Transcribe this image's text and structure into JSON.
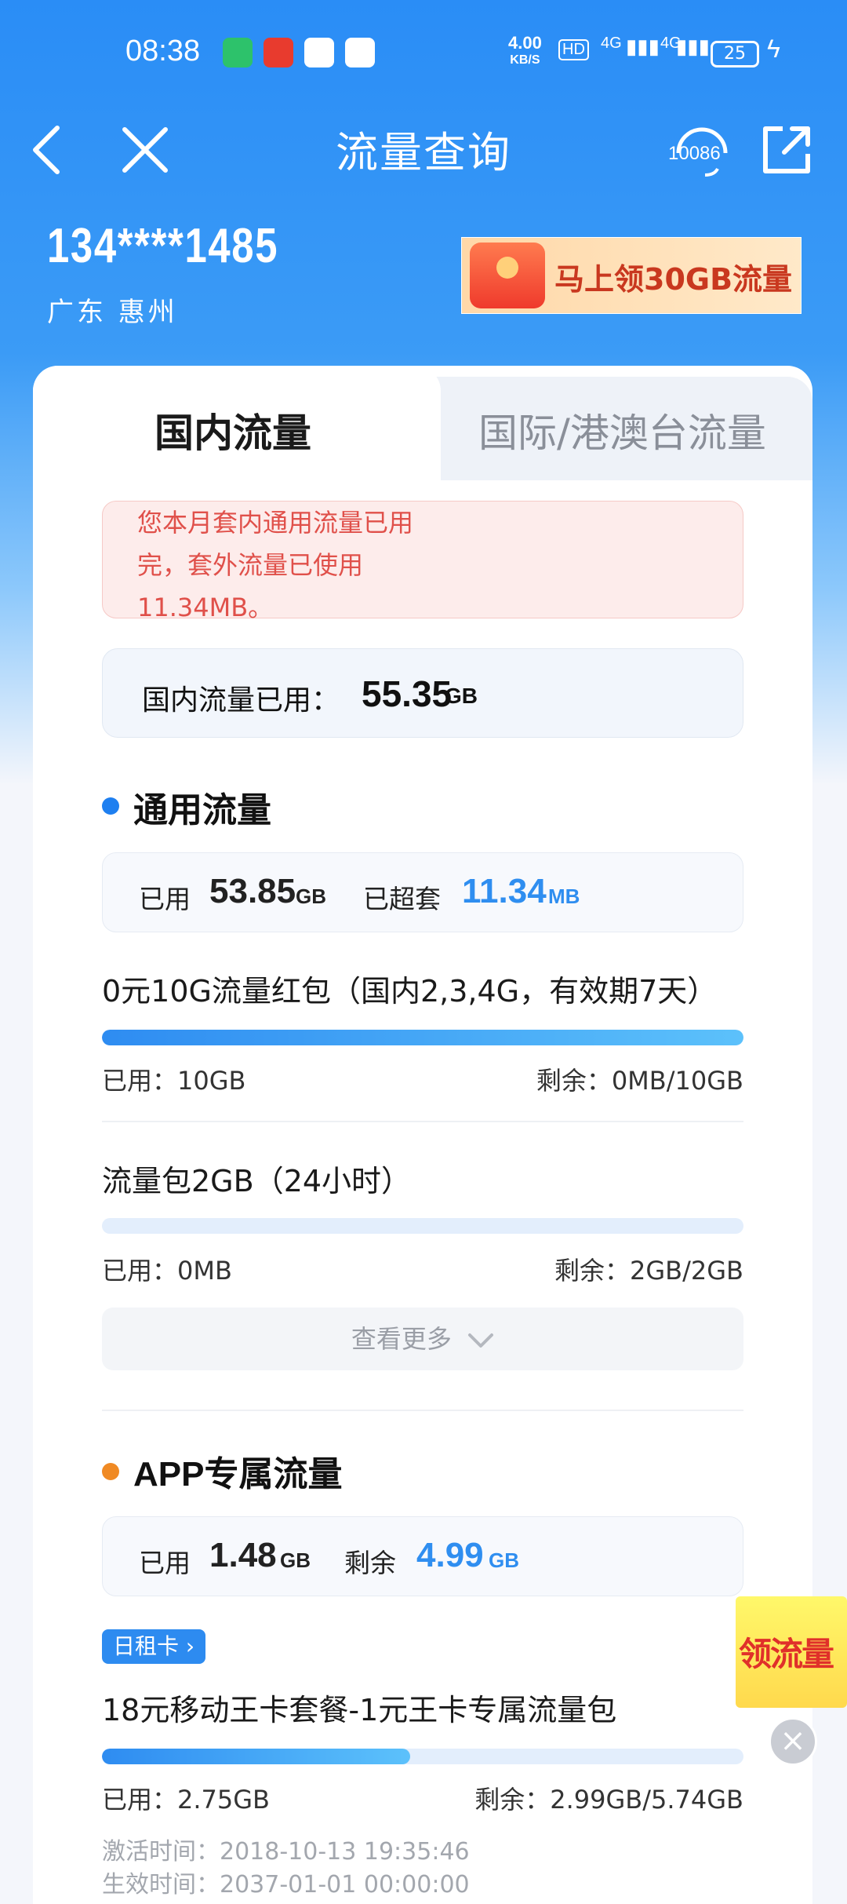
{
  "status_bar": {
    "time": "08:38",
    "net_speed_value": "4.00",
    "net_speed_unit": "KB/S",
    "hd_label": "HD",
    "signal_1": "4G",
    "signal_2": "4G",
    "battery": "25"
  },
  "nav": {
    "title": "流量查询",
    "service_label": "10086"
  },
  "account": {
    "phone": "134****1485",
    "region": "广东 惠州",
    "promo_text": "马上领30GB流量"
  },
  "tabs": {
    "domestic": "国内流量",
    "international": "国际/港澳台流量"
  },
  "alert": {
    "line1": "您本月套内通用流量已用",
    "line2": "完，套外流量已使用",
    "line3": "11.34MB。"
  },
  "domestic_total": {
    "label": "国内流量已用：",
    "value": "55.35",
    "unit": "GB"
  },
  "general": {
    "title": "通用流量",
    "used_label": "已用",
    "used_value": "53.85",
    "used_unit": "GB",
    "over_label": "已超套",
    "over_value": "11.34",
    "over_unit": "MB",
    "packages": [
      {
        "name": "0元10G流量红包（国内2,3,4G，有效期7天）",
        "used": "已用：10GB",
        "remain": "剩余：0MB/10GB",
        "progress": 1.0
      },
      {
        "name": "流量包2GB（24小时）",
        "used": "已用：0MB",
        "remain": "剩余：2GB/2GB",
        "progress": 0.0
      }
    ],
    "more_label": "查看更多"
  },
  "app": {
    "title": "APP专属流量",
    "used_label": "已用",
    "used_value": "1.48",
    "used_unit": "GB",
    "remain_label": "剩余",
    "remain_value": "4.99",
    "remain_unit": "GB",
    "tag": "日租卡 ›",
    "package": {
      "name": "18元移动王卡套餐-1元王卡专属流量包",
      "used": "已用：2.75GB",
      "remain": "剩余：2.99GB/5.74GB",
      "progress": 0.48
    },
    "activated": "激活时间：2018-10-13 19:35:46",
    "effective": "生效时间：2037-01-01 00:00:00"
  },
  "float_ad": {
    "text": "领流量"
  },
  "colors": {
    "brand_blue": "#2a8df6",
    "accent_blue": "#2f8ef0",
    "alert_red": "#e0504a",
    "dot_blue": "#1e7ff0",
    "dot_orange": "#f08a24"
  }
}
